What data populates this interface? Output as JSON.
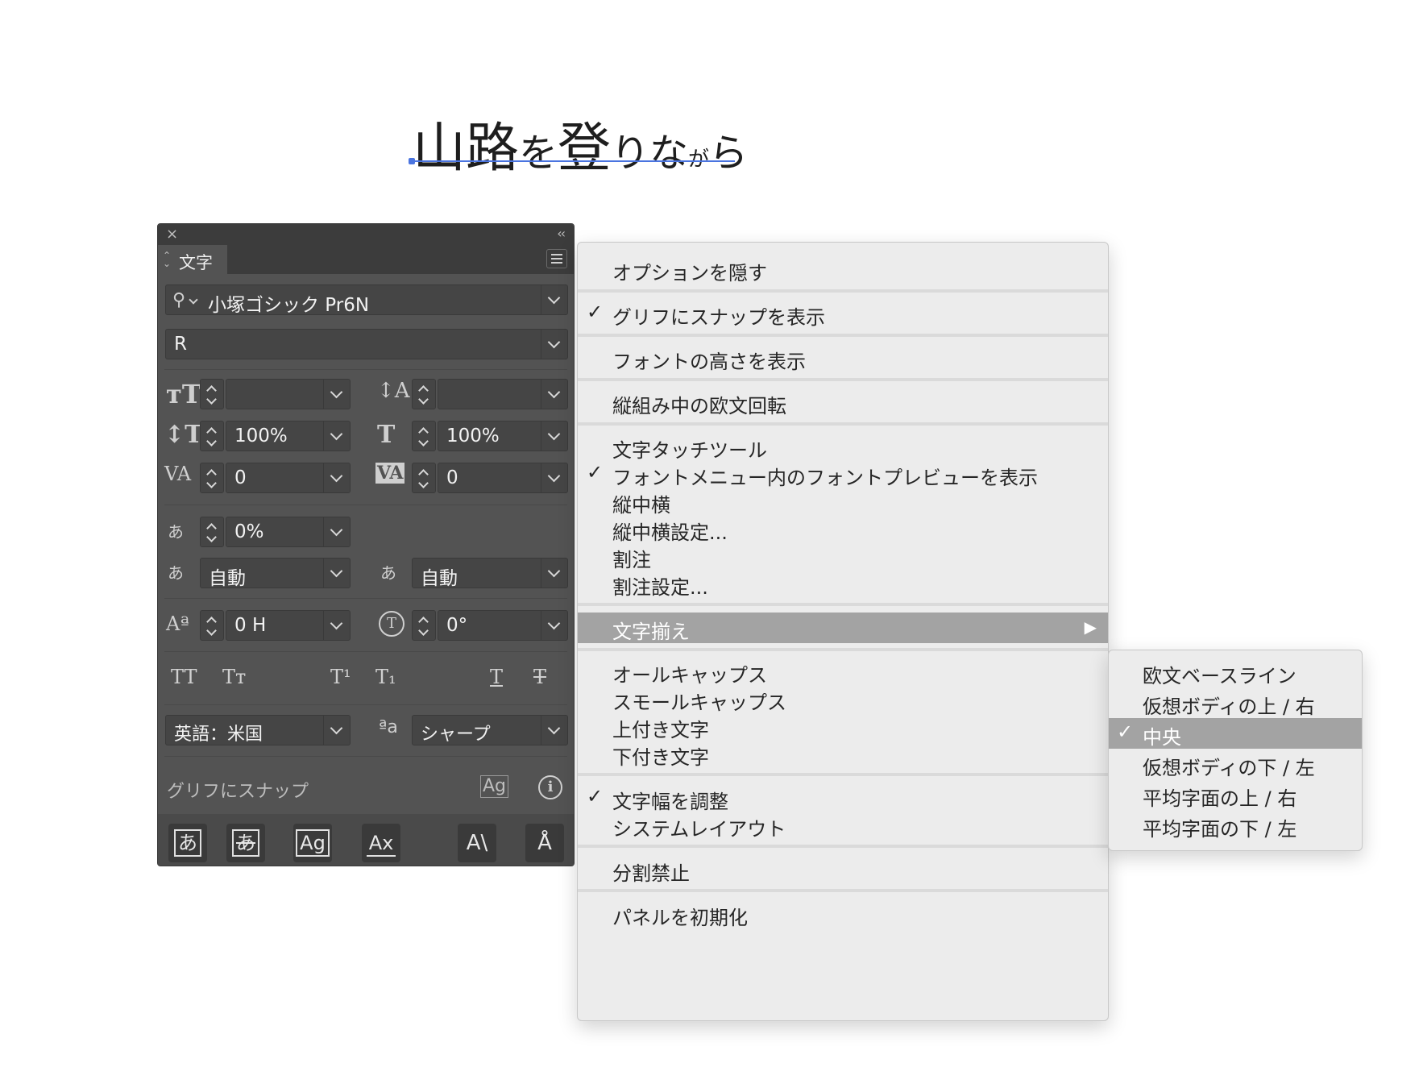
{
  "sample_text": {
    "c1": "山",
    "c2": "路",
    "c3": "を",
    "c4": "登",
    "c5": "り",
    "c6": "な",
    "c7": "が",
    "c8": "ら"
  },
  "panel": {
    "close_glyph": "×",
    "collapse_glyph": "‹‹",
    "tab_label": "文字",
    "font_family": "小塚ゴシック Pr6N",
    "font_style": "R",
    "font_size": "",
    "leading": "",
    "vertical_scale": "100%",
    "horizontal_scale": "100%",
    "kerning": "0",
    "tracking": "0",
    "tsume": "0%",
    "aki_before": "自動",
    "aki_after": "自動",
    "baseline_shift": "0 H",
    "rotation": "0°",
    "style_icons": {
      "all_caps": "TT",
      "small_caps": "Tт",
      "superscript": "T¹",
      "subscript": "T₁",
      "underline": "T",
      "strikethrough": "T"
    },
    "language": "英語：米国",
    "antialias_icon": "ªa",
    "antialias": "シャープ",
    "snap_label": "グリフにスナップ",
    "snap_icon_glyph": "Ag",
    "info_glyph": "i",
    "glyph_buttons": [
      "あ",
      "あ",
      "Ag",
      "Ax",
      "A\\",
      "Å"
    ]
  },
  "menu": {
    "items": [
      {
        "label": "オプションを隠す",
        "checked": false
      },
      {
        "label": "グリフにスナップを表示",
        "checked": true
      },
      {
        "label": "フォントの高さを表示",
        "checked": false
      },
      {
        "label": "縦組み中の欧文回転",
        "checked": false
      },
      {
        "label": "文字タッチツール",
        "checked": false
      },
      {
        "label": "フォントメニュー内のフォントプレビューを表示",
        "checked": true
      },
      {
        "label": "縦中横",
        "checked": false
      },
      {
        "label": "縦中横設定...",
        "checked": false
      },
      {
        "label": "割注",
        "checked": false
      },
      {
        "label": "割注設定...",
        "checked": false
      },
      {
        "label": "文字揃え",
        "checked": false,
        "submenu": true
      },
      {
        "label": "オールキャップス",
        "checked": false
      },
      {
        "label": "スモールキャップス",
        "checked": false
      },
      {
        "label": "上付き文字",
        "checked": false
      },
      {
        "label": "下付き文字",
        "checked": false
      },
      {
        "label": "文字幅を調整",
        "checked": true
      },
      {
        "label": "システムレイアウト",
        "checked": false
      },
      {
        "label": "分割禁止",
        "checked": false
      },
      {
        "label": "パネルを初期化",
        "checked": false
      }
    ],
    "check_glyph": "✓",
    "submenu_arrow": "▶"
  },
  "submenu": {
    "items": [
      {
        "label": "欧文ベースライン",
        "checked": false
      },
      {
        "label": "仮想ボディの上 / 右",
        "checked": false
      },
      {
        "label": "中央",
        "checked": true
      },
      {
        "label": "仮想ボディの下 / 左",
        "checked": false
      },
      {
        "label": "平均字面の上 / 右",
        "checked": false
      },
      {
        "label": "平均字面の下 / 左",
        "checked": false
      }
    ]
  },
  "colors": {
    "panel_bg": "#535353",
    "menu_bg": "#ececec",
    "highlight": "#a3a3a3",
    "accent": "#4a74e0"
  }
}
